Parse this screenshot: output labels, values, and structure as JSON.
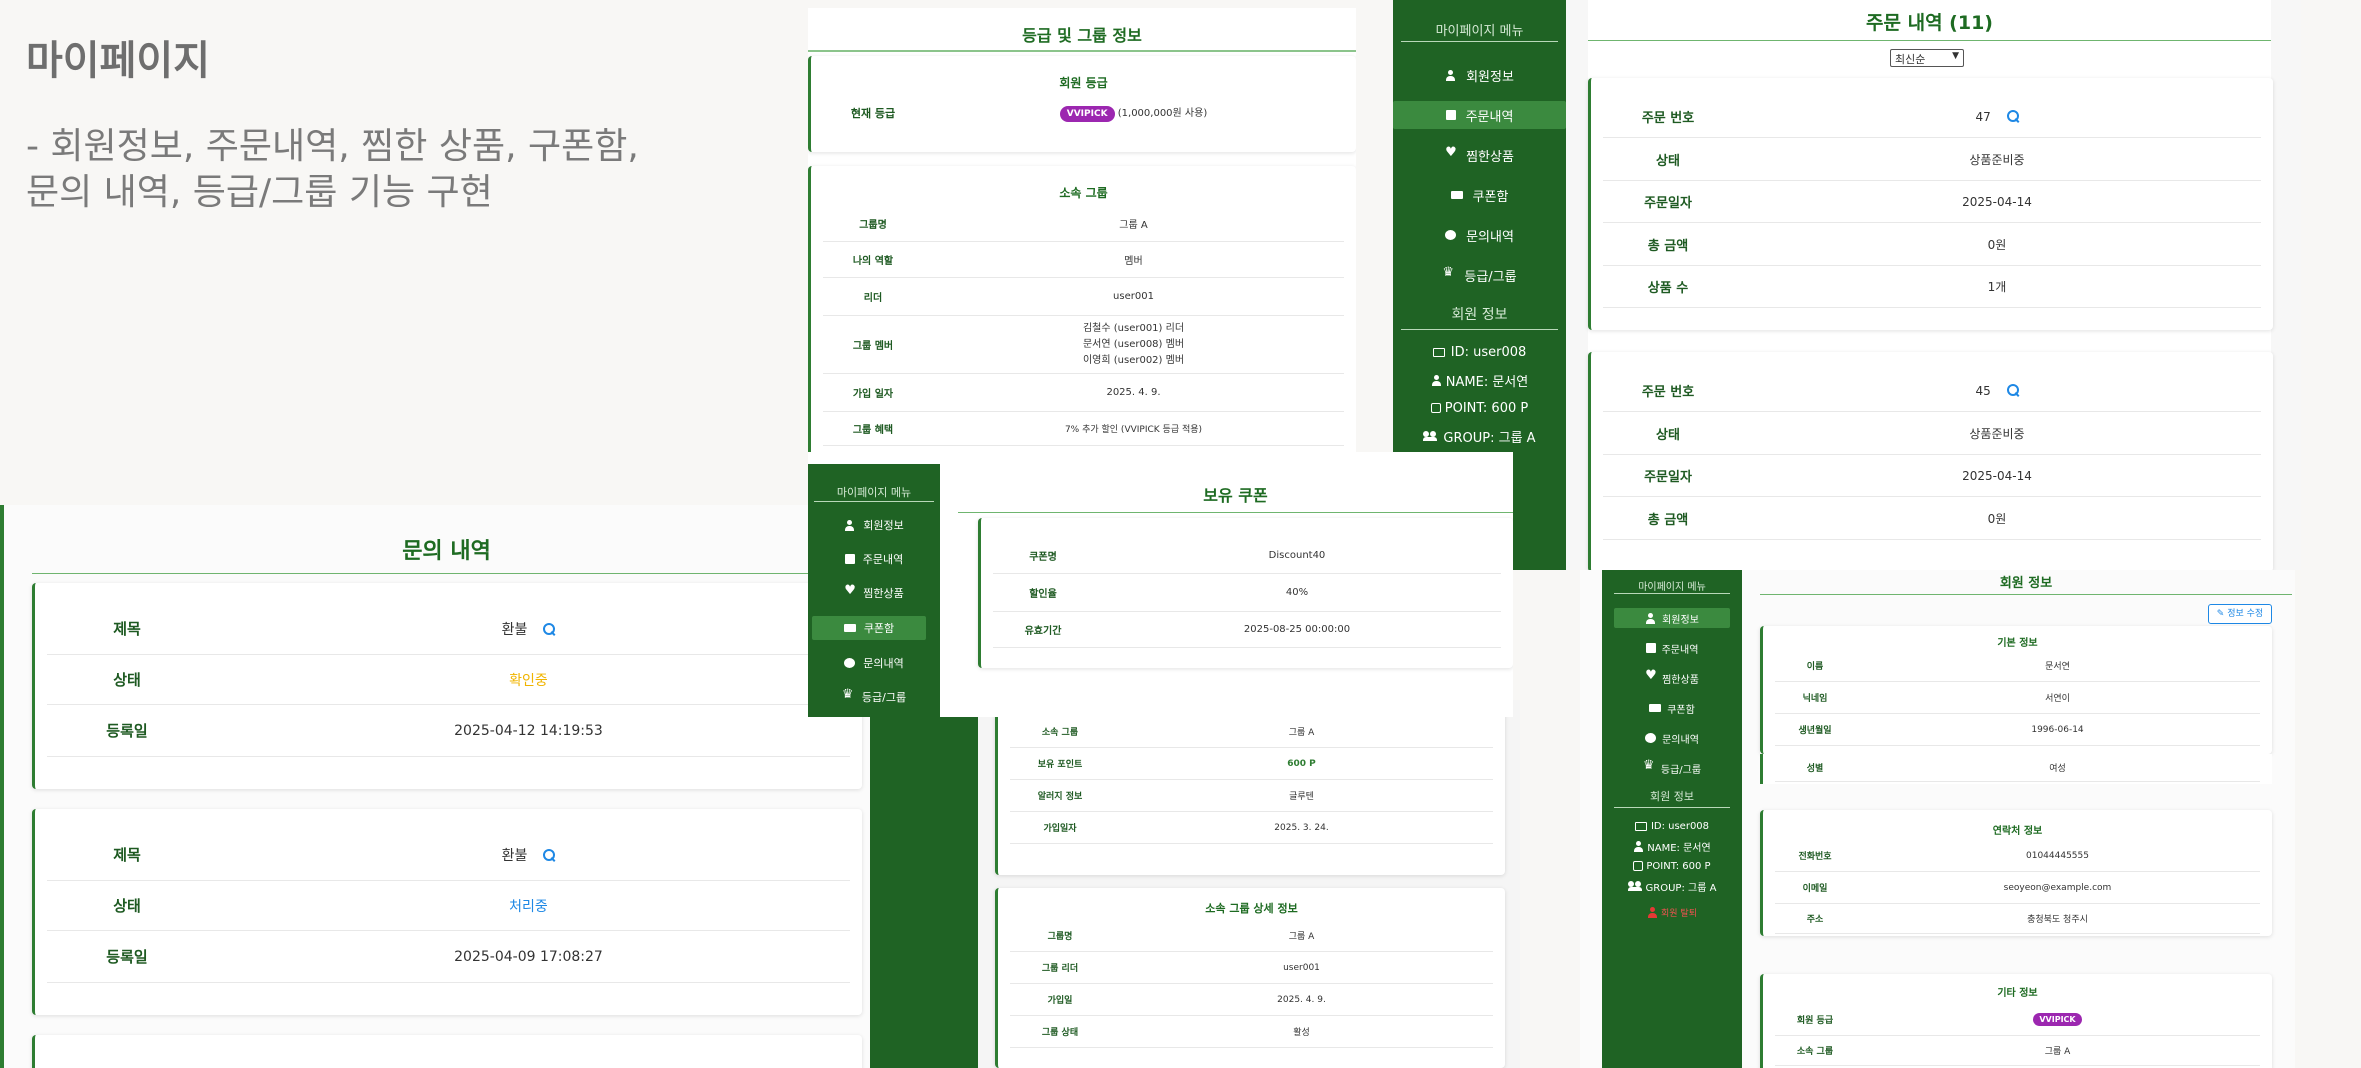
{
  "slide": {
    "title": "마이페이지",
    "description_line1": "- 회원정보, 주문내역, 찜한 상품, 구폰함,",
    "description_line2": "문의 내역, 등급/그룹 기능 구현"
  },
  "grade_panel": {
    "title": "등급 및 그룹 정보",
    "member_grade": {
      "heading": "회원 등급",
      "label": "현재 등급",
      "badge": "VVIPICK",
      "detail": "(1,000,000원 사용)"
    },
    "group": {
      "heading": "소속 그룹",
      "rows": [
        {
          "label": "그룹명",
          "value": "그룹 A"
        },
        {
          "label": "나의 역할",
          "value": "멤버"
        },
        {
          "label": "리더",
          "value": "user001"
        }
      ],
      "members_label": "그룹 멤버",
      "members": [
        "김철수 (user001) 리더",
        "문서연 (user008) 멤버",
        "이영희 (user002) 멤버"
      ],
      "rows2": [
        {
          "label": "가입 일자",
          "value": "2025. 4. 9."
        },
        {
          "label": "그룹 혜택",
          "value": "7% 추가 할인 (VVIPICK 등급 적용)"
        }
      ]
    }
  },
  "sidebar": {
    "menu_title": "마이페이지 메뉴",
    "items": [
      {
        "label": "회원정보",
        "icon": "user-icon"
      },
      {
        "label": "주문내역",
        "icon": "bag-icon"
      },
      {
        "label": "찜한상품",
        "icon": "heart-icon"
      },
      {
        "label": "쿠폰함",
        "icon": "ticket-icon"
      },
      {
        "label": "문의내역",
        "icon": "chat-icon"
      },
      {
        "label": "등급/그룹",
        "icon": "crown-icon"
      }
    ],
    "info_title": "회원 정보",
    "info": {
      "id": "ID: user008",
      "name": "NAME: 문서연",
      "point": "POINT: 600 P",
      "group": "GROUP: 그룹 A"
    },
    "withdraw": "회원 탈퇴"
  },
  "orders": {
    "title": "주문 내역 (11)",
    "sort_selected": "최신순",
    "cards": [
      {
        "rows": [
          {
            "label": "주문 번호",
            "value": "47"
          },
          {
            "label": "상태",
            "value": "상품준비중"
          },
          {
            "label": "주문일자",
            "value": "2025-04-14"
          },
          {
            "label": "총 금액",
            "value": "0원"
          },
          {
            "label": "상품 수",
            "value": "1개"
          }
        ]
      },
      {
        "rows": [
          {
            "label": "주문 번호",
            "value": "45"
          },
          {
            "label": "상태",
            "value": "상품준비중"
          },
          {
            "label": "주문일자",
            "value": "2025-04-14"
          },
          {
            "label": "총 금액",
            "value": "0원"
          }
        ]
      }
    ]
  },
  "inquiries": {
    "title": "문의 내역",
    "cards": [
      {
        "subject_label": "제목",
        "subject": "환불",
        "status_label": "상태",
        "status": "확인중",
        "status_color": "#f0b400",
        "date_label": "등록일",
        "date": "2025-04-12 14:19:53"
      },
      {
        "subject_label": "제목",
        "subject": "환불",
        "status_label": "상태",
        "status": "처리중",
        "status_color": "#1e88e5",
        "date_label": "등록일",
        "date": "2025-04-09 17:08:27"
      }
    ]
  },
  "coupons": {
    "title": "보유 쿠폰",
    "rows": [
      {
        "label": "쿠폰명",
        "value": "Discount40"
      },
      {
        "label": "할인율",
        "value": "40%"
      },
      {
        "label": "유효기간",
        "value": "2025-08-25 00:00:00"
      }
    ]
  },
  "member_info_partial": {
    "rows": [
      {
        "label": "소속 그룹",
        "value": "그룹 A"
      },
      {
        "label": "보유 포인트",
        "value": "600 P"
      },
      {
        "label": "알러지 정보",
        "value": "글루텐"
      },
      {
        "label": "가입일자",
        "value": "2025. 3. 24."
      }
    ],
    "group_detail": {
      "title": "소속 그룹 상세 정보",
      "rows": [
        {
          "label": "그룹명",
          "value": "그룹 A"
        },
        {
          "label": "그룹 리더",
          "value": "user001"
        },
        {
          "label": "가입일",
          "value": "2025. 4. 9."
        },
        {
          "label": "그룹 상태",
          "value": "활성"
        }
      ]
    }
  },
  "member_info": {
    "title": "회원 정보",
    "edit_button": "정보 수정",
    "basic": {
      "heading": "기본 정보",
      "rows": [
        {
          "label": "이름",
          "value": "문서연"
        },
        {
          "label": "닉네임",
          "value": "서연이"
        },
        {
          "label": "생년월일",
          "value": "1996-06-14"
        },
        {
          "label": "성별",
          "value": "여성"
        }
      ]
    },
    "contact": {
      "heading": "연락처 정보",
      "rows": [
        {
          "label": "전화번호",
          "value": "01044445555"
        },
        {
          "label": "이메일",
          "value": "seoyeon@example.com"
        },
        {
          "label": "주소",
          "value": "충청북도 청주시"
        }
      ]
    },
    "etc": {
      "heading": "기타 정보",
      "grade_label": "회원 등급",
      "grade_badge": "VVIPICK",
      "group_label": "소속 그룹",
      "group_value": "그룹 A"
    }
  },
  "colors": {
    "brand_green": "#1f6324",
    "active_green": "#3b8a3f",
    "badge_purple": "#9c27b0",
    "link_blue": "#1e88e5"
  }
}
